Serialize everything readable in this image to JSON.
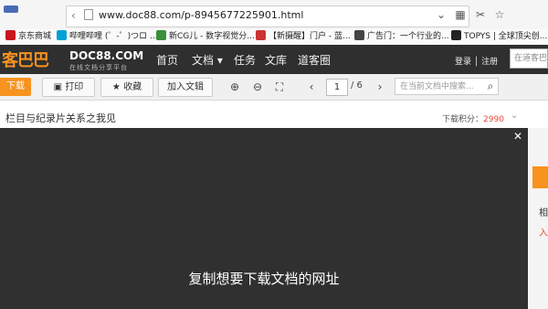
{
  "browser": {
    "url": "www.doc88.com/p-8945677225901.html",
    "icons": [
      "back-icon",
      "page-icon",
      "scroll-icon",
      "qr-icon",
      "star-icon"
    ]
  },
  "bookmarks": [
    {
      "label": "京东商城",
      "color": "#c9151e"
    },
    {
      "label": "哔哩哔哩 (゜-゜)つロ ...",
      "color": "#00a1d6"
    },
    {
      "label": "新CG儿 - 数字视觉分...",
      "color": "#3a8f3a"
    },
    {
      "label": "【新摄醒】门户 - 蓝...",
      "color": "#cc3333"
    },
    {
      "label": "广告门：一个行业的...",
      "color": "#444444"
    },
    {
      "label": "TOPYS | 全球顶尖创...",
      "color": "#222222"
    }
  ],
  "site": {
    "brand_cn": "客巴巴",
    "brand_en": "DOC88.COM",
    "brand_tag": "在线文档分享平台",
    "nav": [
      "首页",
      "文档 ▾",
      "任务",
      "文库",
      "道客圈"
    ],
    "login": "登录 │ 注册",
    "search_placeholder": "在道客巴巴"
  },
  "toolbar": {
    "download": "下载",
    "print": "打印",
    "favorite": "收藏",
    "add_to_lib": "加入文辑",
    "page_current": "1",
    "page_total": "/ 6",
    "search_placeholder": "在当前文档中搜索..."
  },
  "doc": {
    "title": "栏目与纪录片关系之我见",
    "points_label": "下载积分：",
    "points_value": "2990"
  },
  "overlay": {
    "subtitle": "复制想要下载文档的网址"
  },
  "right_strip": {
    "text1": "相",
    "text2": "入"
  },
  "colors": {
    "accent": "#f7931e",
    "header_bg": "#2f2f2f",
    "overlay_bg": "#303030",
    "points": "#e74c3c"
  }
}
